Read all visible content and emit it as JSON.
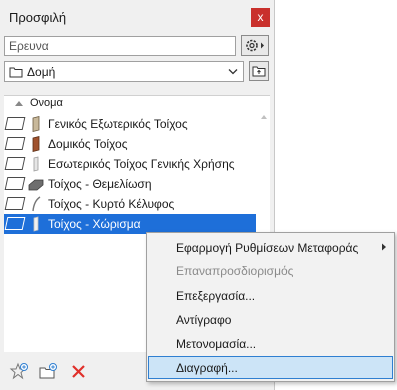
{
  "panel": {
    "title": "Προσφιλή",
    "close_glyph": "x",
    "search_placeholder": "Ερευνα",
    "folder_label": "Δομή"
  },
  "list": {
    "column_header": "Ονομα",
    "rows": [
      {
        "label": "Γενικός Εξωτερικός Τοίχος",
        "icon": "wall-exterior-icon",
        "selected": false
      },
      {
        "label": "Δομικός Τοίχος",
        "icon": "wall-structural-icon",
        "selected": false
      },
      {
        "label": "Εσωτερικός Τοίχος Γενικής Χρήσης",
        "icon": "wall-interior-icon",
        "selected": false
      },
      {
        "label": "Τοίχος - Θεμελίωση",
        "icon": "wall-foundation-icon",
        "selected": false
      },
      {
        "label": "Τοίχος - Κυρτό Κέλυφος",
        "icon": "wall-curved-shell-icon",
        "selected": false
      },
      {
        "label": "Τοίχος - Χώρισμα",
        "icon": "wall-partition-icon",
        "selected": true
      }
    ]
  },
  "context_menu": {
    "items": [
      {
        "label": "Εφαρμογή Ρυθμίσεων Μεταφοράς",
        "has_submenu": true,
        "disabled": false
      },
      {
        "label": "Επαναπροσδιορισμός",
        "has_submenu": false,
        "disabled": true
      },
      {
        "label": "Επεξεργασία...",
        "has_submenu": false,
        "disabled": false
      },
      {
        "label": "Αντίγραφο",
        "has_submenu": false,
        "disabled": false
      },
      {
        "label": "Μετονομασία...",
        "has_submenu": false,
        "disabled": false
      },
      {
        "label": "Διαγραφή...",
        "has_submenu": false,
        "disabled": false,
        "highlighted": true
      }
    ]
  },
  "colors": {
    "selection": "#1e6fd9",
    "close_button": "#c9302c",
    "delete_icon": "#e0302a",
    "menu_highlight": "#cce4f7"
  }
}
